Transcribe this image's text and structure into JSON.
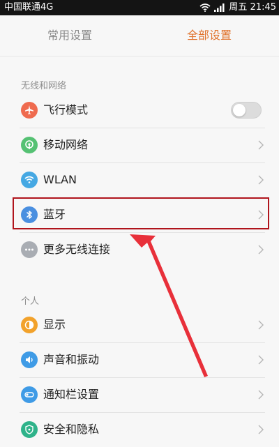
{
  "status_bar": {
    "carrier": "中国联通4G",
    "time": "周五 21:45"
  },
  "tabs": [
    {
      "label": "常用设置",
      "active": false
    },
    {
      "label": "全部设置",
      "active": true
    }
  ],
  "sections": [
    {
      "title": "无线和网络",
      "items": [
        {
          "label": "飞行模式",
          "icon": "airplane-icon",
          "icon_color": "#ef6b4f",
          "control": "toggle",
          "toggle_on": false
        },
        {
          "label": "移动网络",
          "icon": "mobile-network-icon",
          "icon_color": "#55c173",
          "control": "chevron"
        },
        {
          "label": "WLAN",
          "icon": "wifi-icon",
          "icon_color": "#45a8e3",
          "control": "chevron"
        },
        {
          "label": "蓝牙",
          "icon": "bluetooth-icon",
          "icon_color": "#4a8fe0",
          "control": "chevron"
        },
        {
          "label": "更多无线连接",
          "icon": "more-icon",
          "icon_color": "#a9adb3",
          "control": "chevron"
        }
      ]
    },
    {
      "title": "个人",
      "items": [
        {
          "label": "显示",
          "icon": "display-icon",
          "icon_color": "#f2a22b",
          "control": "chevron"
        },
        {
          "label": "声音和振动",
          "icon": "sound-icon",
          "icon_color": "#3f9be6",
          "control": "chevron"
        },
        {
          "label": "通知栏设置",
          "icon": "notification-icon",
          "icon_color": "#3f9be6",
          "control": "chevron"
        },
        {
          "label": "安全和隐私",
          "icon": "security-icon",
          "icon_color": "#2fb38a",
          "control": "chevron"
        }
      ]
    }
  ],
  "colors": {
    "accent": "#e0722b",
    "highlight": "#b0141c",
    "arrow": "#e8303a"
  }
}
